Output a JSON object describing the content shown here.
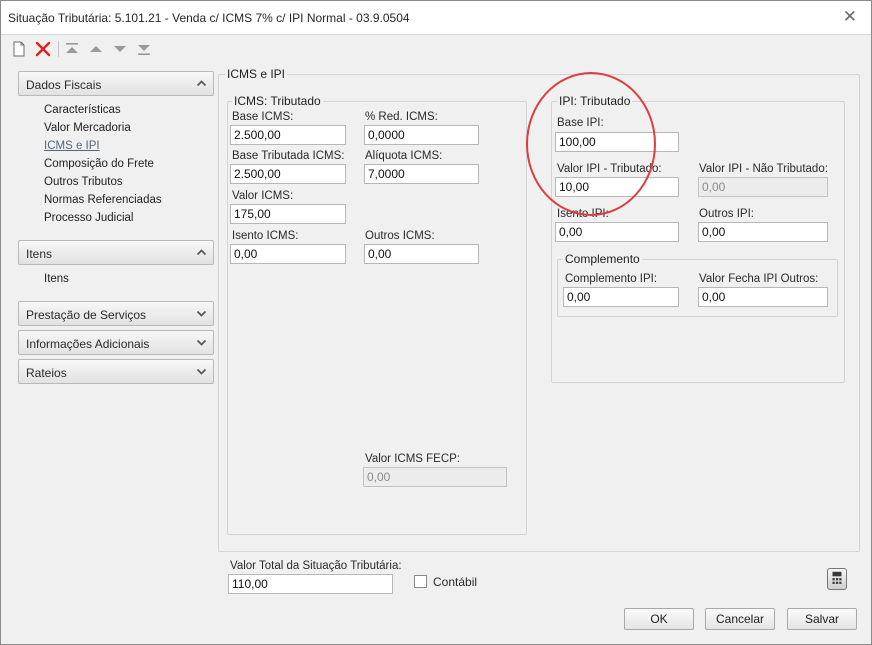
{
  "window": {
    "title": "Situação Tributária: 5.101.21 - Venda c/ ICMS 7% c/ IPI Normal - 03.9.0504"
  },
  "toolbar": {
    "icons": [
      "new-document-icon",
      "delete-icon",
      "move-first-icon",
      "move-up-icon",
      "move-down-icon",
      "move-last-icon"
    ]
  },
  "nav": {
    "dados_fiscais": {
      "label": "Dados Fiscais",
      "items": [
        "Características",
        "Valor Mercadoria",
        "ICMS e IPI",
        "Composição do Frete",
        "Outros Tributos",
        "Normas Referenciadas",
        "Processo Judicial"
      ]
    },
    "itens": {
      "label": "Itens",
      "items": [
        "Itens"
      ]
    },
    "prestacao": {
      "label": "Prestação de Serviços"
    },
    "informacoes": {
      "label": "Informações Adicionais"
    },
    "rateios": {
      "label": "Rateios"
    }
  },
  "main": {
    "group_title": "ICMS e IPI",
    "icms": {
      "title": "ICMS: Tributado",
      "base_icms": {
        "label": "Base ICMS:",
        "value": "2.500,00"
      },
      "red_icms": {
        "label": "% Red. ICMS:",
        "value": "0,0000"
      },
      "base_trib": {
        "label": "Base Tributada ICMS:",
        "value": "2.500,00"
      },
      "aliquota": {
        "label": "Alíquota ICMS:",
        "value": "7,0000"
      },
      "valor_icms": {
        "label": "Valor ICMS:",
        "value": "175,00"
      },
      "isento": {
        "label": "Isento ICMS:",
        "value": "0,00"
      },
      "outros": {
        "label": "Outros ICMS:",
        "value": "0,00"
      },
      "fecp": {
        "label": "Valor ICMS FECP:",
        "value": "0,00"
      }
    },
    "ipi": {
      "title": "IPI: Tributado",
      "base_ipi": {
        "label": "Base IPI:",
        "value": "100,00"
      },
      "valor_trib": {
        "label": "Valor IPI - Tributado:",
        "value": "10,00"
      },
      "valor_nao_trib": {
        "label": "Valor IPI - Não Tributado:",
        "value": "0,00"
      },
      "isento": {
        "label": "Isento IPI:",
        "value": "0,00"
      },
      "outros": {
        "label": "Outros IPI:",
        "value": "0,00"
      },
      "complemento": {
        "title": "Complemento",
        "comp_ipi": {
          "label": "Complemento IPI:",
          "value": "0,00"
        },
        "fecha": {
          "label": "Valor Fecha IPI Outros:",
          "value": "0,00"
        }
      }
    }
  },
  "footer": {
    "total_label": "Valor Total da Situação Tributária:",
    "total_value": "110,00",
    "contabil_label": "Contábil",
    "ok": "OK",
    "cancelar": "Cancelar",
    "salvar": "Salvar"
  },
  "colors": {
    "annotation": "#db3f3f",
    "delete": "#e02020",
    "active_nav": "#55657a"
  }
}
